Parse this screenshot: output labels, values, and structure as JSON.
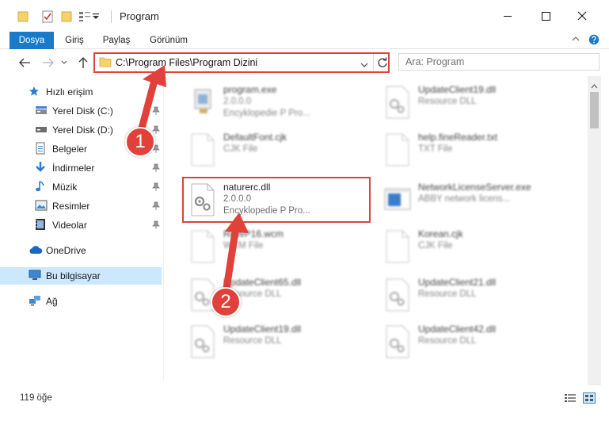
{
  "window": {
    "title": "Program"
  },
  "ribbon": {
    "tabs": [
      "Dosya",
      "Giriş",
      "Paylaş",
      "Görünüm"
    ]
  },
  "address": {
    "path": "C:\\Program Files\\Program Dizini"
  },
  "search": {
    "placeholder": "Ara: Program"
  },
  "sidebar": {
    "items": [
      {
        "label": "Hızlı erişim",
        "icon": "star-icon"
      },
      {
        "label": "Yerel Disk (C:)",
        "icon": "drive-icon"
      },
      {
        "label": "Yerel Disk (D:)",
        "icon": "drive-icon"
      },
      {
        "label": "Belgeler",
        "icon": "documents-icon"
      },
      {
        "label": "İndirmeler",
        "icon": "download-icon"
      },
      {
        "label": "Müzik",
        "icon": "music-icon"
      },
      {
        "label": "Resimler",
        "icon": "pictures-icon"
      },
      {
        "label": "Videolar",
        "icon": "videos-icon"
      },
      {
        "label": "OneDrive",
        "icon": "cloud-icon"
      },
      {
        "label": "Bu bilgisayar",
        "icon": "computer-icon"
      },
      {
        "label": "Ağ",
        "icon": "network-icon"
      }
    ]
  },
  "files": [
    {
      "name": "program.exe",
      "line1": "2.0.0.0",
      "line2": "Encyklopedie P   Pro...",
      "kind": "exe"
    },
    {
      "name": "UpdateClient19.dll",
      "line1": "Resource DLL",
      "line2": "",
      "kind": "dll"
    },
    {
      "name": "DefaultFont.cjk",
      "line1": "CJK File",
      "line2": "",
      "kind": "blank"
    },
    {
      "name": "help.fineReader.txt",
      "line1": "TXT File",
      "line2": "",
      "kind": "blank"
    },
    {
      "name": "naturerc.dll",
      "line1": "2.0.0.0",
      "line2": "Encyklopedie P   Pro...",
      "kind": "dll"
    },
    {
      "name": "NetworkLicenseServer.exe",
      "line1": "ABBY network licens...",
      "line2": "",
      "kind": "app"
    },
    {
      "name": "ReWP16.wcm",
      "line1": "WCM File",
      "line2": "",
      "kind": "blank"
    },
    {
      "name": "Korean.cjk",
      "line1": "CJK File",
      "line2": "",
      "kind": "blank"
    },
    {
      "name": "UpdateClient65.dll",
      "line1": "Resource DLL",
      "line2": "",
      "kind": "dll"
    },
    {
      "name": "UpdateClient21.dll",
      "line1": "Resource DLL",
      "line2": "",
      "kind": "dll"
    },
    {
      "name": "UpdateClient19.dll",
      "line1": "Resource DLL",
      "line2": "",
      "kind": "dll"
    },
    {
      "name": "UpdateClient42.dll",
      "line1": "Resource DLL",
      "line2": "",
      "kind": "dll"
    }
  ],
  "status": {
    "count": "119 öğe"
  },
  "annotations": {
    "step1": "1",
    "step2": "2",
    "color": "#e0413a"
  },
  "colors": {
    "accent": "#1979ca",
    "selection": "#cce8ff"
  }
}
